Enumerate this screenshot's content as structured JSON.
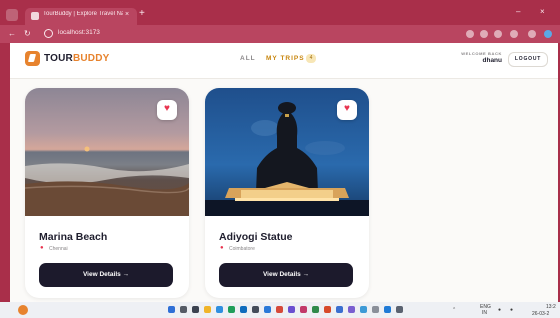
{
  "browser": {
    "tab_title": "TourBuddy | Explore Travel Nam",
    "tab_close": "×",
    "new_tab": "+",
    "url": "localhost:3173",
    "minimize": "–",
    "close": "×"
  },
  "header": {
    "logo_prefix": "TOUR",
    "logo_suffix": "BUDDY",
    "nav_all": "ALL",
    "nav_my_trips": "MY TRIPS",
    "my_trips_count": "4",
    "welcome_label": "WELCOME BACK",
    "username": "dhanu",
    "logout_label": "LOGOUT"
  },
  "cards": [
    {
      "title": "Marina Beach",
      "location": "Chennai",
      "button_label": "View Details →",
      "heart": "♥"
    },
    {
      "title": "Adiyogi Statue",
      "location": "Coimbatore",
      "button_label": "View Details →",
      "heart": "♥"
    }
  ],
  "taskbar": {
    "lang": "ENG",
    "lang_sub": "IN",
    "time": "13:2",
    "date": "26-03-2"
  },
  "colors": {
    "browser_frame": "#a92f4a",
    "accent_orange": "#e7832e",
    "my_trips_gold": "#c8860e",
    "button_dark": "#1c1a2c",
    "heart_red": "#e8344f"
  }
}
